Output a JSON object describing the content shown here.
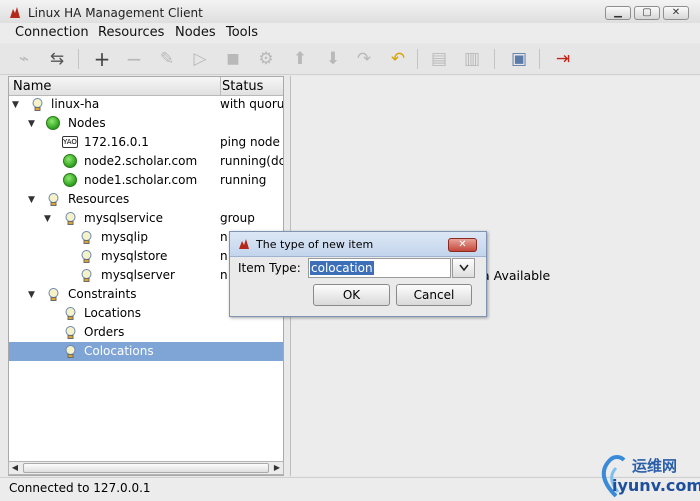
{
  "window": {
    "title": "Linux HA Management Client",
    "min_label": "▁",
    "max_label": "▢",
    "close_label": "✕"
  },
  "menu": [
    "Connection",
    "Resources",
    "Nodes",
    "Tools"
  ],
  "toolbar": {
    "icons": [
      "disconnect-icon",
      "connect-icon",
      "add-icon",
      "remove-icon",
      "cleanup-icon",
      "start-icon",
      "stop-icon",
      "gears-icon",
      "move-up-icon",
      "move-down-icon",
      "redo-icon",
      "undo-icon",
      "standby-node-icon",
      "active-node-icon",
      "view-log-icon",
      "exit-icon"
    ]
  },
  "tree": {
    "headers": {
      "name": "Name",
      "status": "Status"
    },
    "rows": [
      {
        "label": "linux-ha",
        "status": "with quoru",
        "toggle": "▼",
        "icon": "bulb-icon"
      },
      {
        "label": "Nodes",
        "status": "",
        "toggle": "▼",
        "icon": "node-group-icon"
      },
      {
        "label": "172.16.0.1",
        "status": "ping node",
        "toggle": "",
        "icon": "ping-node-icon"
      },
      {
        "label": "node2.scholar.com",
        "status": "running(dc",
        "toggle": "",
        "icon": "node-online-icon"
      },
      {
        "label": "node1.scholar.com",
        "status": "running",
        "toggle": "",
        "icon": "node-online-icon"
      },
      {
        "label": "Resources",
        "status": "",
        "toggle": "▼",
        "icon": "bulb-icon"
      },
      {
        "label": "mysqlservice",
        "status": "group",
        "toggle": "▼",
        "icon": "bulb-icon"
      },
      {
        "label": "mysqlip",
        "status": "n",
        "toggle": "",
        "icon": "bulb-icon"
      },
      {
        "label": "mysqlstore",
        "status": "n",
        "toggle": "",
        "icon": "bulb-icon"
      },
      {
        "label": "mysqlserver",
        "status": "n",
        "toggle": "",
        "icon": "bulb-icon"
      },
      {
        "label": "Constraints",
        "status": "",
        "toggle": "▼",
        "icon": "bulb-icon"
      },
      {
        "label": "Locations",
        "status": "",
        "toggle": "",
        "icon": "bulb-icon"
      },
      {
        "label": "Orders",
        "status": "",
        "toggle": "",
        "icon": "bulb-icon"
      },
      {
        "label": "Colocations",
        "status": "",
        "toggle": "",
        "icon": "bulb-icon",
        "selected": true
      }
    ]
  },
  "right_panel": {
    "message": "a Available"
  },
  "dialog": {
    "title": "The type of new item",
    "field_label": "Item Type:",
    "value": "colocation",
    "ok": "OK",
    "cancel": "Cancel"
  },
  "status_bar": "Connected to 127.0.0.1",
  "watermark": {
    "top": "运维网",
    "bottom": "iyunv.com"
  },
  "colors": {
    "selection": "#7fa5d6",
    "node_online": "#2ca11d",
    "dialog_close": "#c4473a"
  }
}
